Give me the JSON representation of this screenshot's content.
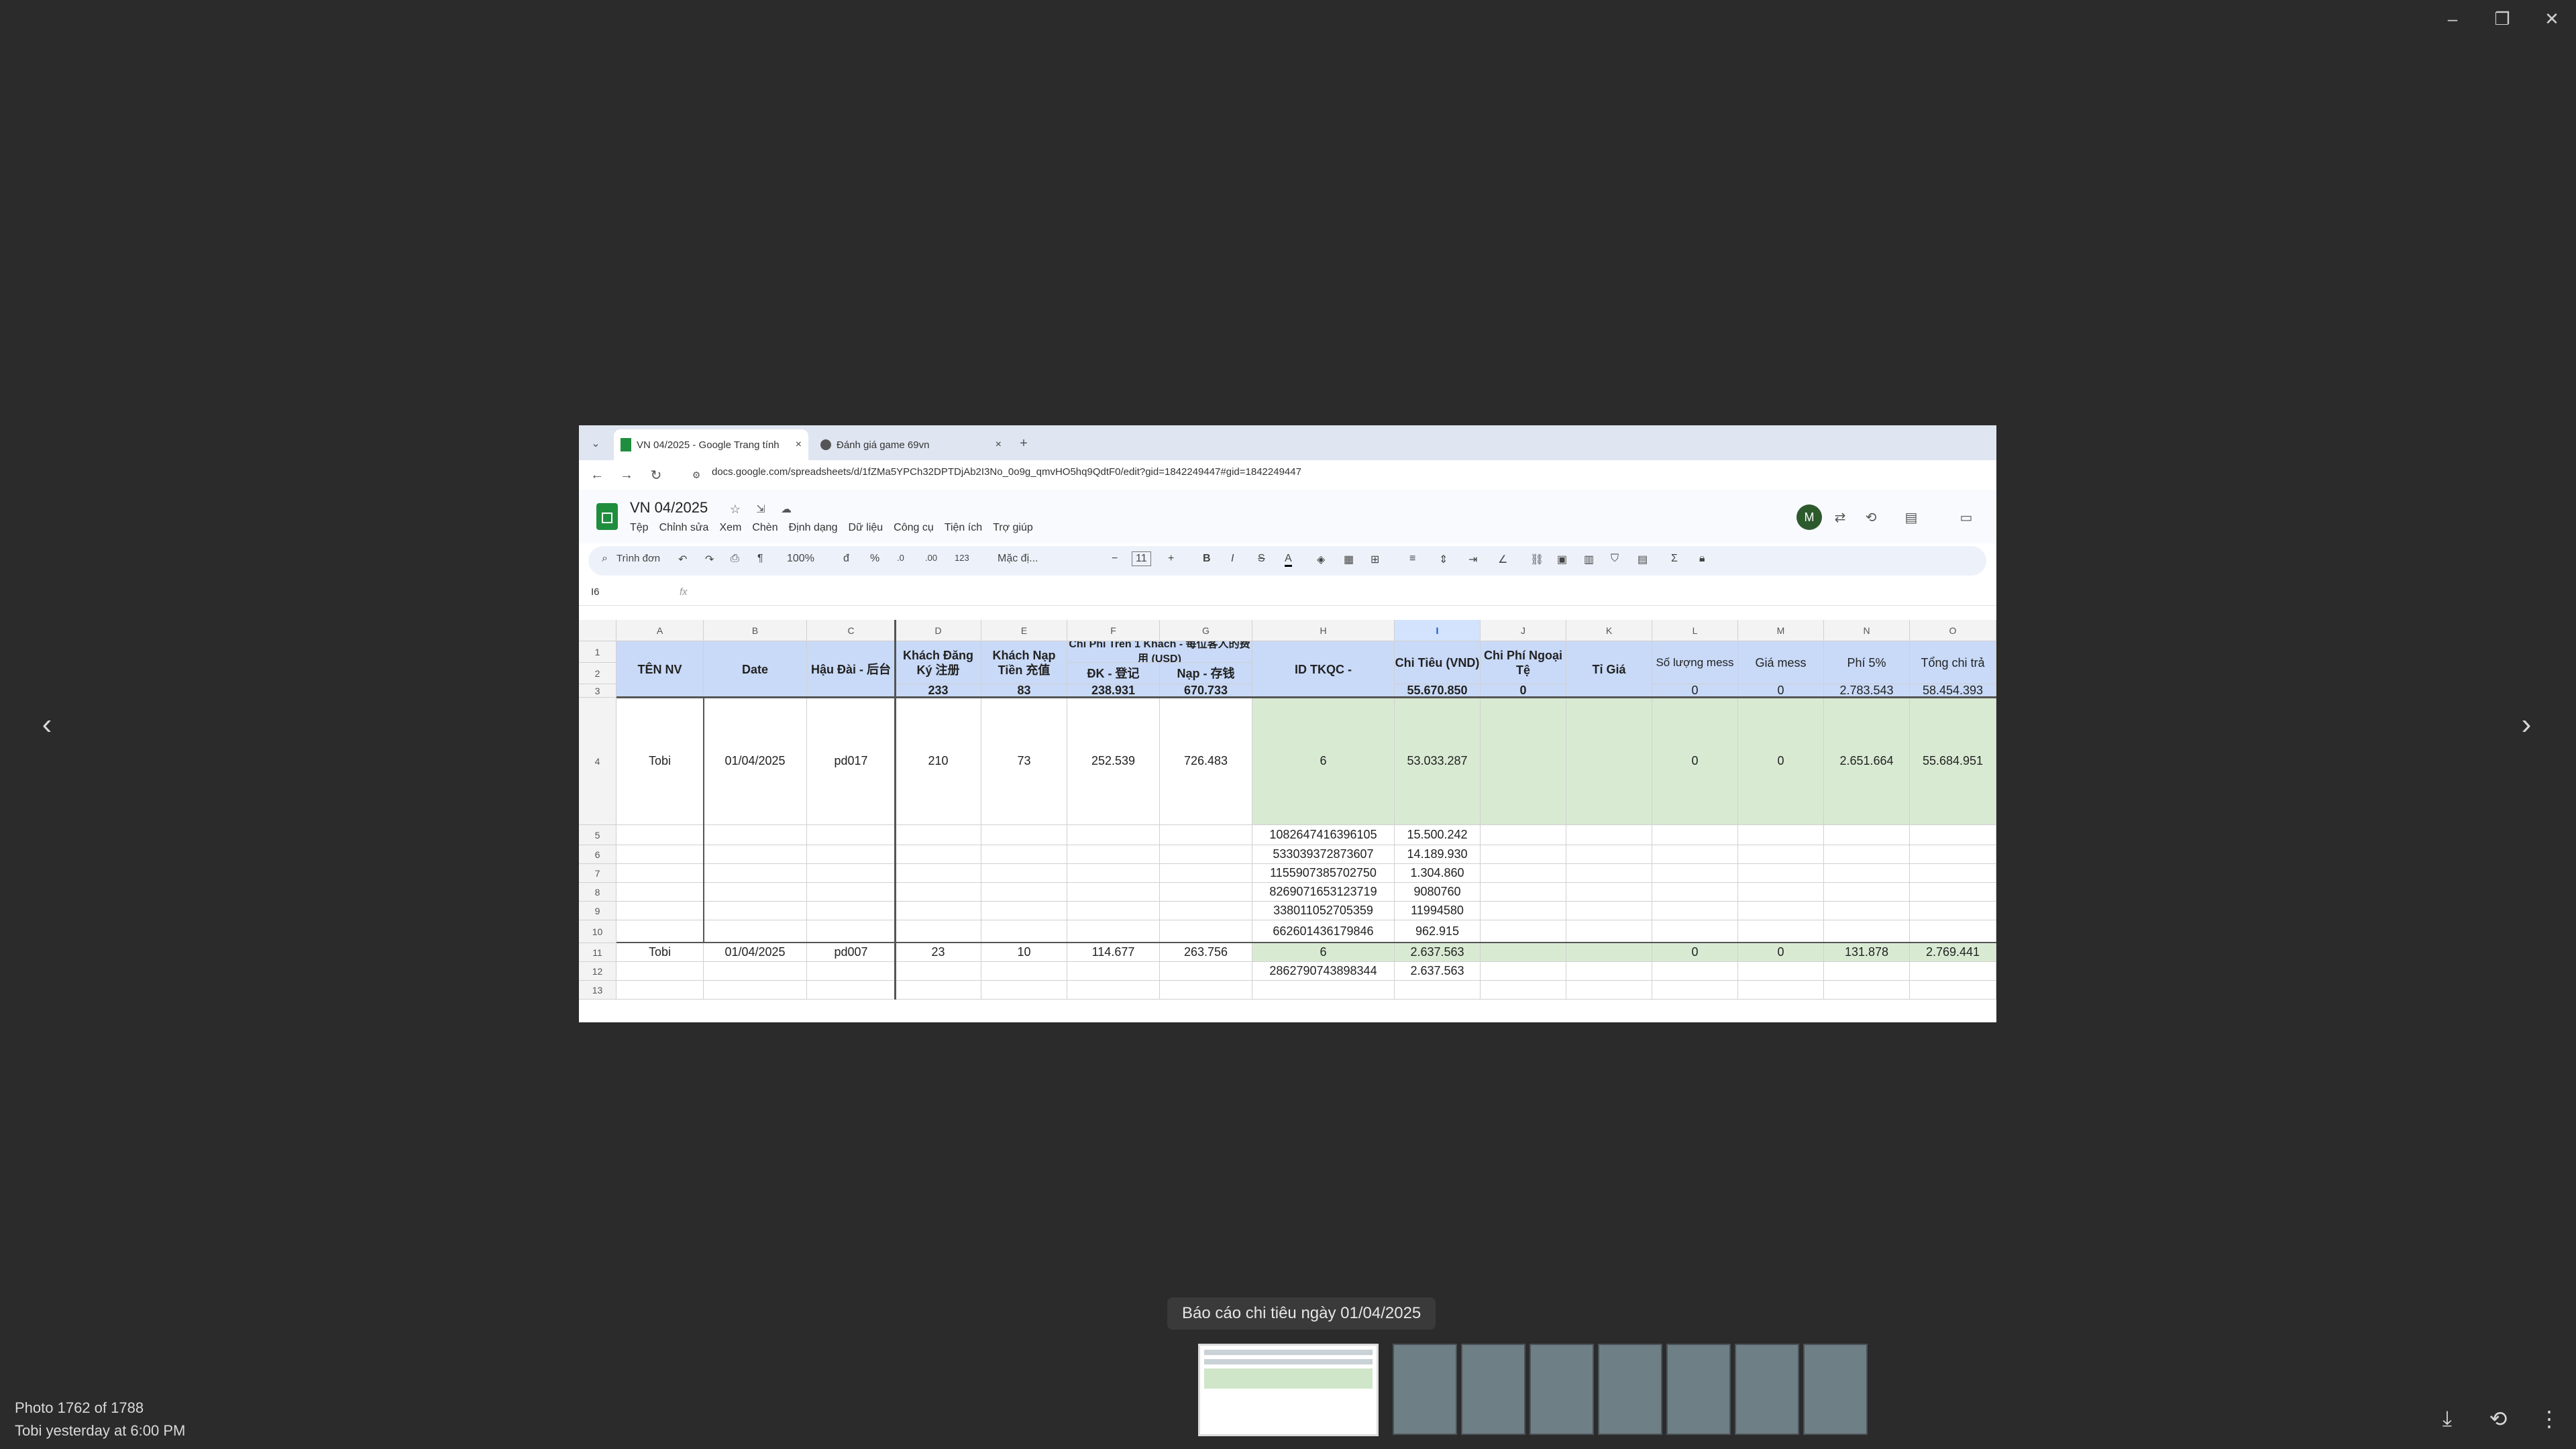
{
  "viewer": {
    "caption": "Báo cáo chi tiêu ngày 01/04/2025",
    "photo_counter": "Photo 1762 of 1788",
    "photo_meta": "Tobi   yesterday at 6:00 PM",
    "win_minimize": "–",
    "win_restore": "❐",
    "win_close": "✕",
    "prev": "‹",
    "next": "›",
    "download_icon": "⤓",
    "rotate_icon": "⟲",
    "more_icon": "⋮"
  },
  "browser": {
    "tabs": [
      {
        "label": "VN 04/2025 - Google Trang tính"
      },
      {
        "label": "Đánh giá game 69vn"
      }
    ],
    "url": "docs.google.com/spreadsheets/d/1fZMa5YPCh32DPTDjAb2I3No_0o9g_qmvHO5hq9QdtF0/edit?gid=1842249447#gid=1842249447"
  },
  "sheet": {
    "title": "VN 04/2025",
    "menu": [
      "Tệp",
      "Chỉnh sửa",
      "Xem",
      "Chèn",
      "Định dạng",
      "Dữ liệu",
      "Công cụ",
      "Tiện ích",
      "Trợ giúp"
    ],
    "avatar": "M",
    "toolbar": {
      "search": "Trình đơn",
      "zoom": "100%",
      "currency": "đ",
      "percent": "%",
      "dec_minus": ".0",
      "dec_plus": ".00",
      "num": "123",
      "font": "Mặc đị...",
      "font_size": "11",
      "bold": "B",
      "italic": "I",
      "strike": "S",
      "color": "A"
    },
    "namebox": "I6",
    "fx": "fx",
    "columns": [
      "A",
      "B",
      "C",
      "D",
      "E",
      "F",
      "G",
      "H",
      "I",
      "J",
      "K",
      "L",
      "M",
      "N",
      "O"
    ],
    "rows": [
      "1",
      "2",
      "3",
      "4",
      "5",
      "6",
      "7",
      "8",
      "9",
      "10",
      "11",
      "12",
      "13"
    ],
    "headers": {
      "a": "TÊN NV",
      "b": "Date",
      "c": "Hậu Đài - 后台",
      "d": "Khách Đăng Ký 注册",
      "e": "Khách Nạp Tiền 充值",
      "fg": "Chi Phí Trên 1 Khách - 每位客人的费用 (USD)",
      "f2": "ĐK - 登记",
      "g2": "Nạp - 存钱",
      "h": "ID TKQC -",
      "i": "Chi Tiêu (VND)",
      "j": "Chi Phí Ngoại Tệ",
      "k": "Tỉ Giá",
      "l": "Số lượng mess",
      "m": "Giá mess",
      "n": "Phí 5%",
      "o": "Tổng chi trả"
    },
    "sum_row": {
      "d": "233",
      "e": "83",
      "f": "238.931",
      "g": "670.733",
      "i": "55.670.850",
      "j": "0",
      "l": "0",
      "m": "0",
      "n": "2.783.543",
      "o": "58.454.393"
    },
    "row4": {
      "a": "Tobi",
      "b": "01/04/2025",
      "c": "pd017",
      "d": "210",
      "e": "73",
      "f": "252.539",
      "g": "726.483",
      "h": "6",
      "i": "53.033.287",
      "l": "0",
      "m": "0",
      "n": "2.651.664",
      "o": "55.684.951"
    },
    "detail_rows": [
      {
        "h": "1082647416396105",
        "i": "15.500.242"
      },
      {
        "h": "533039372873607",
        "i": "14.189.930"
      },
      {
        "h": "1155907385702750",
        "i": "1.304.860"
      },
      {
        "h": "8269071653123719",
        "i": "9080760"
      },
      {
        "h": "338011052705359",
        "i": "11994580"
      },
      {
        "h": "662601436179846",
        "i": "962.915"
      }
    ],
    "row11": {
      "a": "Tobi",
      "b": "01/04/2025",
      "c": "pd007",
      "d": "23",
      "e": "10",
      "f": "114.677",
      "g": "263.756",
      "h": "6",
      "i": "2.637.563",
      "l": "0",
      "m": "0",
      "n": "131.878",
      "o": "2.769.441"
    },
    "row12": {
      "h": "2862790743898344",
      "i": "2.637.563"
    }
  },
  "colors": {
    "header_blue": "#c9daf8",
    "green_fill": "#d9ead3",
    "viewer_bg": "#2b2b2b"
  }
}
